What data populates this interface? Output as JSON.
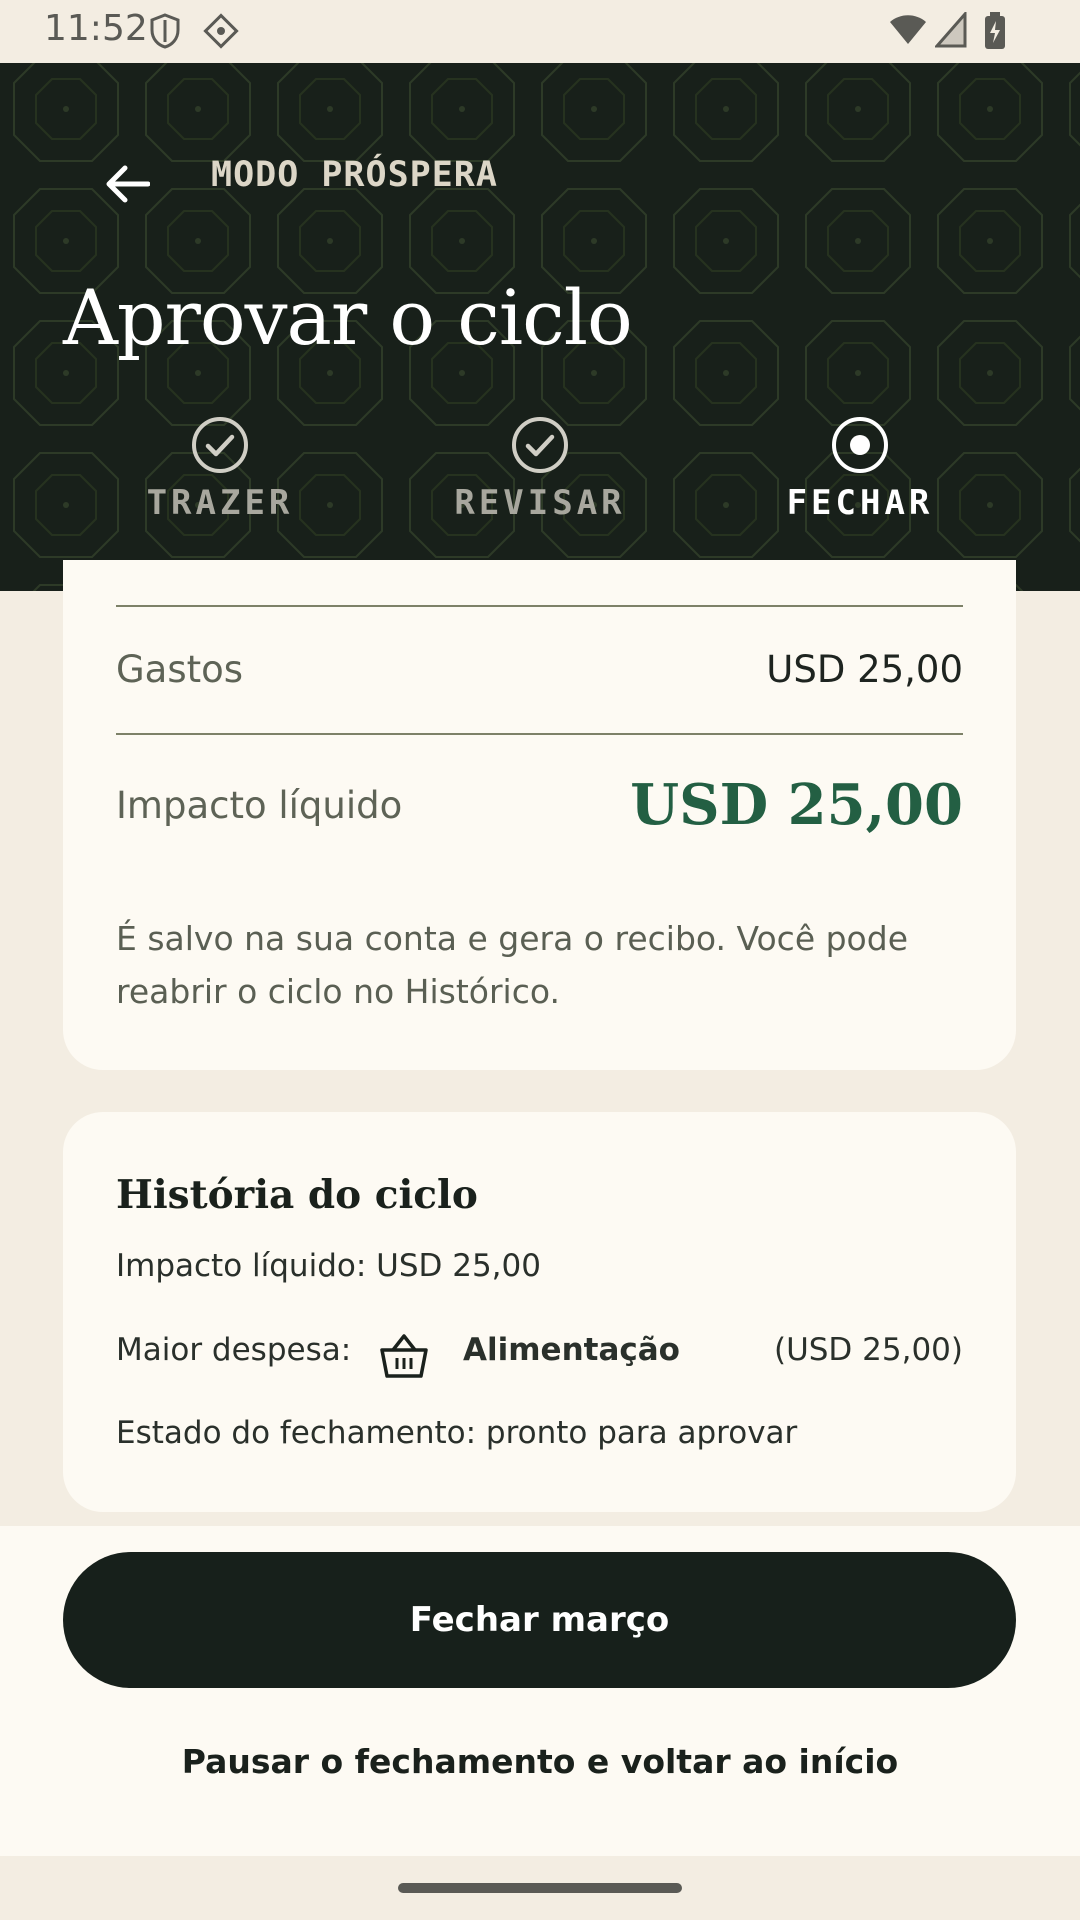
{
  "status_bar": {
    "time": "11:52",
    "icons": [
      "shield-icon",
      "vpn-icon",
      "wifi-icon",
      "signal-icon",
      "battery-charging-icon"
    ]
  },
  "header": {
    "app_name": "MODO PRÓSPERA",
    "title": "Aprovar o ciclo",
    "steps": [
      {
        "label": "TRAZER",
        "state": "done"
      },
      {
        "label": "REVISAR",
        "state": "done"
      },
      {
        "label": "FECHAR",
        "state": "current"
      }
    ]
  },
  "summary": {
    "expenses_label": "Gastos",
    "expenses_value": "USD 25,00",
    "net_label": "Impacto líquido",
    "net_value": "USD 25,00",
    "note": "É salvo na sua conta e gera o recibo. Você pode reabrir o ciclo no Histórico."
  },
  "story": {
    "title": "História do ciclo",
    "net_line": "Impacto líquido: USD 25,00",
    "top_expense_label": "Maior despesa:",
    "top_expense_category": "Alimentação",
    "top_expense_amount": "(USD 25,00)",
    "status_line": "Estado do fechamento: pronto para aprovar"
  },
  "actions": {
    "primary": "Fechar março",
    "secondary": "Pausar o fechamento e voltar ao início"
  },
  "colors": {
    "header_bg": "#18201a",
    "accent_green": "#235f43",
    "card_bg": "#fdfaf3",
    "page_bg": "#f3ede2"
  }
}
